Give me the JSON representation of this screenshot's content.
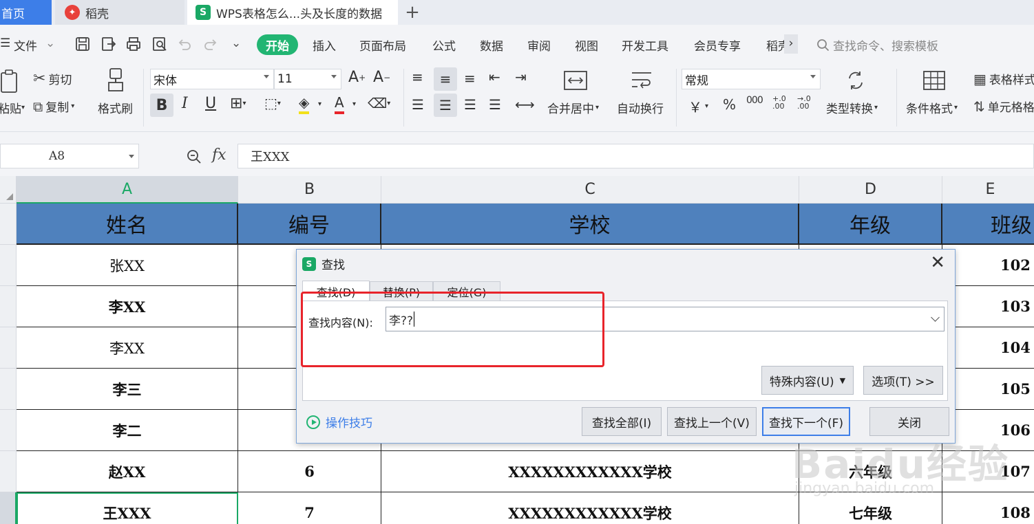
{
  "tabs": {
    "home": "首页",
    "daoke": "稻壳",
    "doc": "WPS表格怎么...头及长度的数据",
    "add": "+"
  },
  "menu": {
    "file": "文件",
    "start": "开始",
    "items": [
      "插入",
      "页面布局",
      "公式",
      "数据",
      "审阅",
      "视图",
      "开发工具",
      "会员专享",
      "稻壳"
    ],
    "more": "›",
    "search": "查找命令、搜索模板"
  },
  "ribbon": {
    "paste": "粘贴",
    "cut": "剪切",
    "copy": "复制",
    "format_painter": "格式刷",
    "font_name": "宋体",
    "font_size": "11",
    "merge_center": "合并居中",
    "auto_wrap": "自动换行",
    "number_format": "常规",
    "type_convert": "类型转换",
    "conditional_format": "条件格式",
    "table_style": "表格样式",
    "cell_style": "单元格格式",
    "currency": "￥",
    "percent": "%",
    "thousands": "000",
    "inc_decimal": "+.0 .00",
    "dec_decimal": "→.0 .00"
  },
  "formula_bar": {
    "cell_ref": "A8",
    "fx": "fx",
    "content": "王XXX"
  },
  "sheet": {
    "columns": [
      "A",
      "B",
      "C",
      "D",
      "E"
    ],
    "header_row": [
      "姓名",
      "编号",
      "学校",
      "年级",
      "班级"
    ],
    "rows": [
      {
        "name": "张XX",
        "id": "",
        "school": "",
        "grade": "",
        "class": "102",
        "bold": false
      },
      {
        "name": "李XX",
        "id": "",
        "school": "",
        "grade": "",
        "class": "103",
        "bold": true
      },
      {
        "name": "李XX",
        "id": "",
        "school": "",
        "grade": "",
        "class": "104",
        "bold": false
      },
      {
        "name": "李三",
        "id": "",
        "school": "",
        "grade": "",
        "class": "105",
        "bold": true
      },
      {
        "name": "李二",
        "id": "",
        "school": "",
        "grade": "",
        "class": "106",
        "bold": true
      },
      {
        "name": "赵XX",
        "id": "6",
        "school": "XXXXXXXXXXXX学校",
        "grade": "六年级",
        "class": "107",
        "bold": true
      },
      {
        "name": "王XXX",
        "id": "7",
        "school": "XXXXXXXXXXXX学校",
        "grade": "七年级",
        "class": "108",
        "bold": true
      }
    ]
  },
  "dialog": {
    "title": "查找",
    "tabs": [
      "查找(D)",
      "替换(P)",
      "定位(G)"
    ],
    "find_label": "查找内容(N):",
    "find_value": "李??",
    "special_button": "特殊内容(U)",
    "options_button": "选项(T) >>",
    "tips": "操作技巧",
    "find_all": "查找全部(I)",
    "find_prev": "查找上一个(V)",
    "find_next": "查找下一个(F)",
    "close": "关闭"
  },
  "watermark": {
    "brand": "Baidu经验",
    "url": "jingyan.baidu.com"
  },
  "colors": {
    "accent_green": "#22b573",
    "header_blue": "#4f81bd",
    "highlight_red": "#e8242b",
    "tab_blue": "#3d7ee8"
  }
}
